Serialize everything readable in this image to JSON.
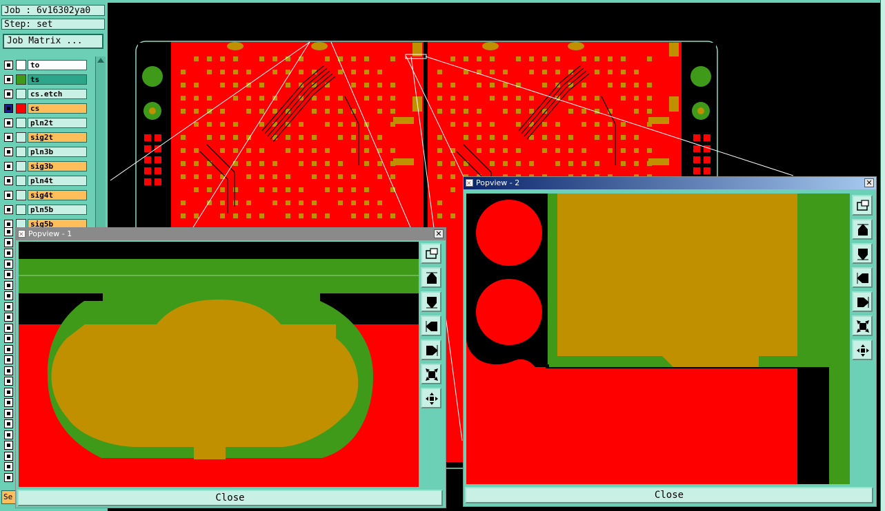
{
  "job_line": "Job : 6v16302ya0",
  "step_line": "Step: set",
  "job_matrix_label": "Job Matrix ...",
  "bottom_left_clip": "Se",
  "layers": [
    {
      "name": "to",
      "swatch": "#ffffff",
      "label_bg": "#ffffff",
      "active": false
    },
    {
      "name": "ts",
      "swatch": "#3f9a1a",
      "label_bg": "#2ca58a",
      "active": false
    },
    {
      "name": "cs.etch",
      "swatch": "#c8f0e4",
      "label_bg": "#c8f0e4",
      "active": false
    },
    {
      "name": "cs",
      "swatch": "#ff0000",
      "label_bg": "#ffbe5a",
      "active": true
    },
    {
      "name": "pln2t",
      "swatch": "#c8f0e4",
      "label_bg": "#c8f0e4",
      "active": false
    },
    {
      "name": "sig2t",
      "swatch": "#c8f0e4",
      "label_bg": "#ffbe5a",
      "active": false
    },
    {
      "name": "pln3b",
      "swatch": "#c8f0e4",
      "label_bg": "#c8f0e4",
      "active": false
    },
    {
      "name": "sig3b",
      "swatch": "#c8f0e4",
      "label_bg": "#ffbe5a",
      "active": false
    },
    {
      "name": "pln4t",
      "swatch": "#c8f0e4",
      "label_bg": "#c8f0e4",
      "active": false
    },
    {
      "name": "sig4t",
      "swatch": "#c8f0e4",
      "label_bg": "#ffbe5a",
      "active": false
    },
    {
      "name": "pln5b",
      "swatch": "#c8f0e4",
      "label_bg": "#c8f0e4",
      "active": false
    },
    {
      "name": "sig5b",
      "swatch": "#c8f0e4",
      "label_bg": "#ffbe5a",
      "active": false
    }
  ],
  "popview1": {
    "title": "Popview - 1",
    "close_label": "Close",
    "title_bg": "#8a8a8a"
  },
  "popview2": {
    "title": "Popview - 2",
    "close_label": "Close",
    "title_bg": "#0a246a"
  },
  "toolbar_icons": [
    "zoom-window-icon",
    "pan-up-icon",
    "pan-down-icon",
    "pan-left-icon",
    "pan-right-icon",
    "zoom-out-icon",
    "zoom-in-icon"
  ],
  "colors": {
    "copper": "#ff0000",
    "pad": "#c09000",
    "mask": "#3f9a1a",
    "background": "#000000",
    "panel": "#6bd0b5"
  }
}
